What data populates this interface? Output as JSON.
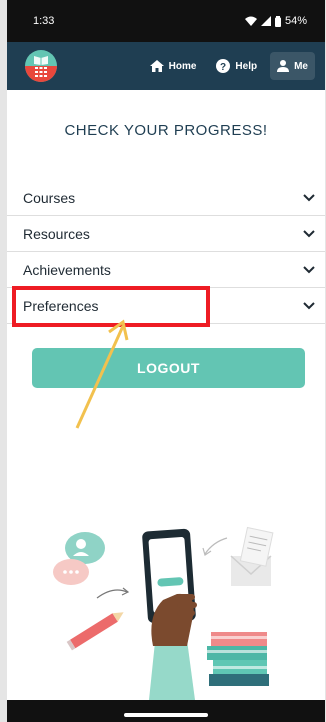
{
  "status": {
    "time": "1:33",
    "battery": "54%"
  },
  "nav": {
    "home": "Home",
    "help": "Help",
    "me": "Me"
  },
  "page": {
    "title": "CHECK YOUR PROGRESS!"
  },
  "menu": [
    {
      "label": "Courses"
    },
    {
      "label": "Resources"
    },
    {
      "label": "Achievements"
    },
    {
      "label": "Preferences"
    }
  ],
  "logout_label": "LOGOUT",
  "colors": {
    "appbar": "#1f3e52",
    "accent": "#63c5b3",
    "highlight": "#ee1c24",
    "arrow": "#f2c14e"
  },
  "icons": [
    "wifi-icon",
    "signal-icon",
    "battery-icon",
    "home-icon",
    "help-icon",
    "person-icon",
    "chevron-down-icon"
  ]
}
